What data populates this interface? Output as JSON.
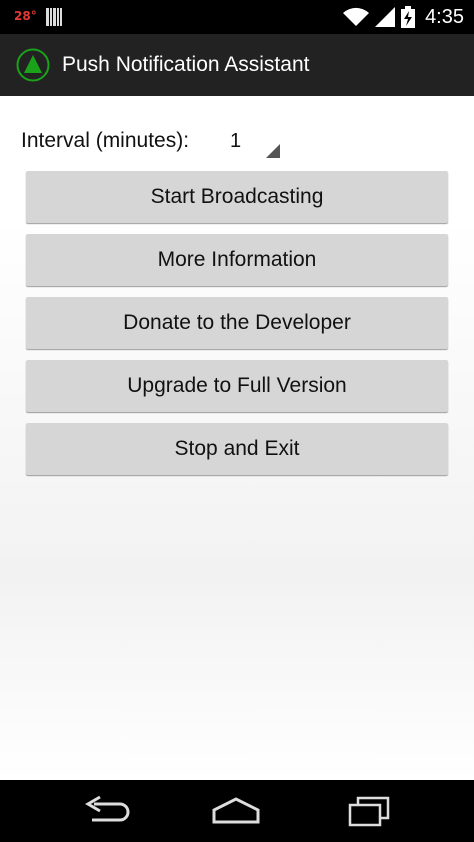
{
  "status_bar": {
    "temperature": "28°",
    "time": "4:35"
  },
  "action_bar": {
    "title": "Push Notification Assistant",
    "icon": "green-triangle-app-icon"
  },
  "interval": {
    "label": "Interval (minutes):",
    "value": "1"
  },
  "buttons": [
    {
      "label": "Start Broadcasting"
    },
    {
      "label": "More Information"
    },
    {
      "label": "Donate to the Developer"
    },
    {
      "label": "Upgrade to Full Version"
    },
    {
      "label": "Stop and Exit"
    }
  ],
  "nav_bar": {
    "icons": [
      "back-icon",
      "home-icon",
      "recents-icon"
    ]
  },
  "colors": {
    "accent": "#1aa31a",
    "action_bar": "#222222",
    "button": "#d6d6d6",
    "temperature": "#e53935"
  }
}
